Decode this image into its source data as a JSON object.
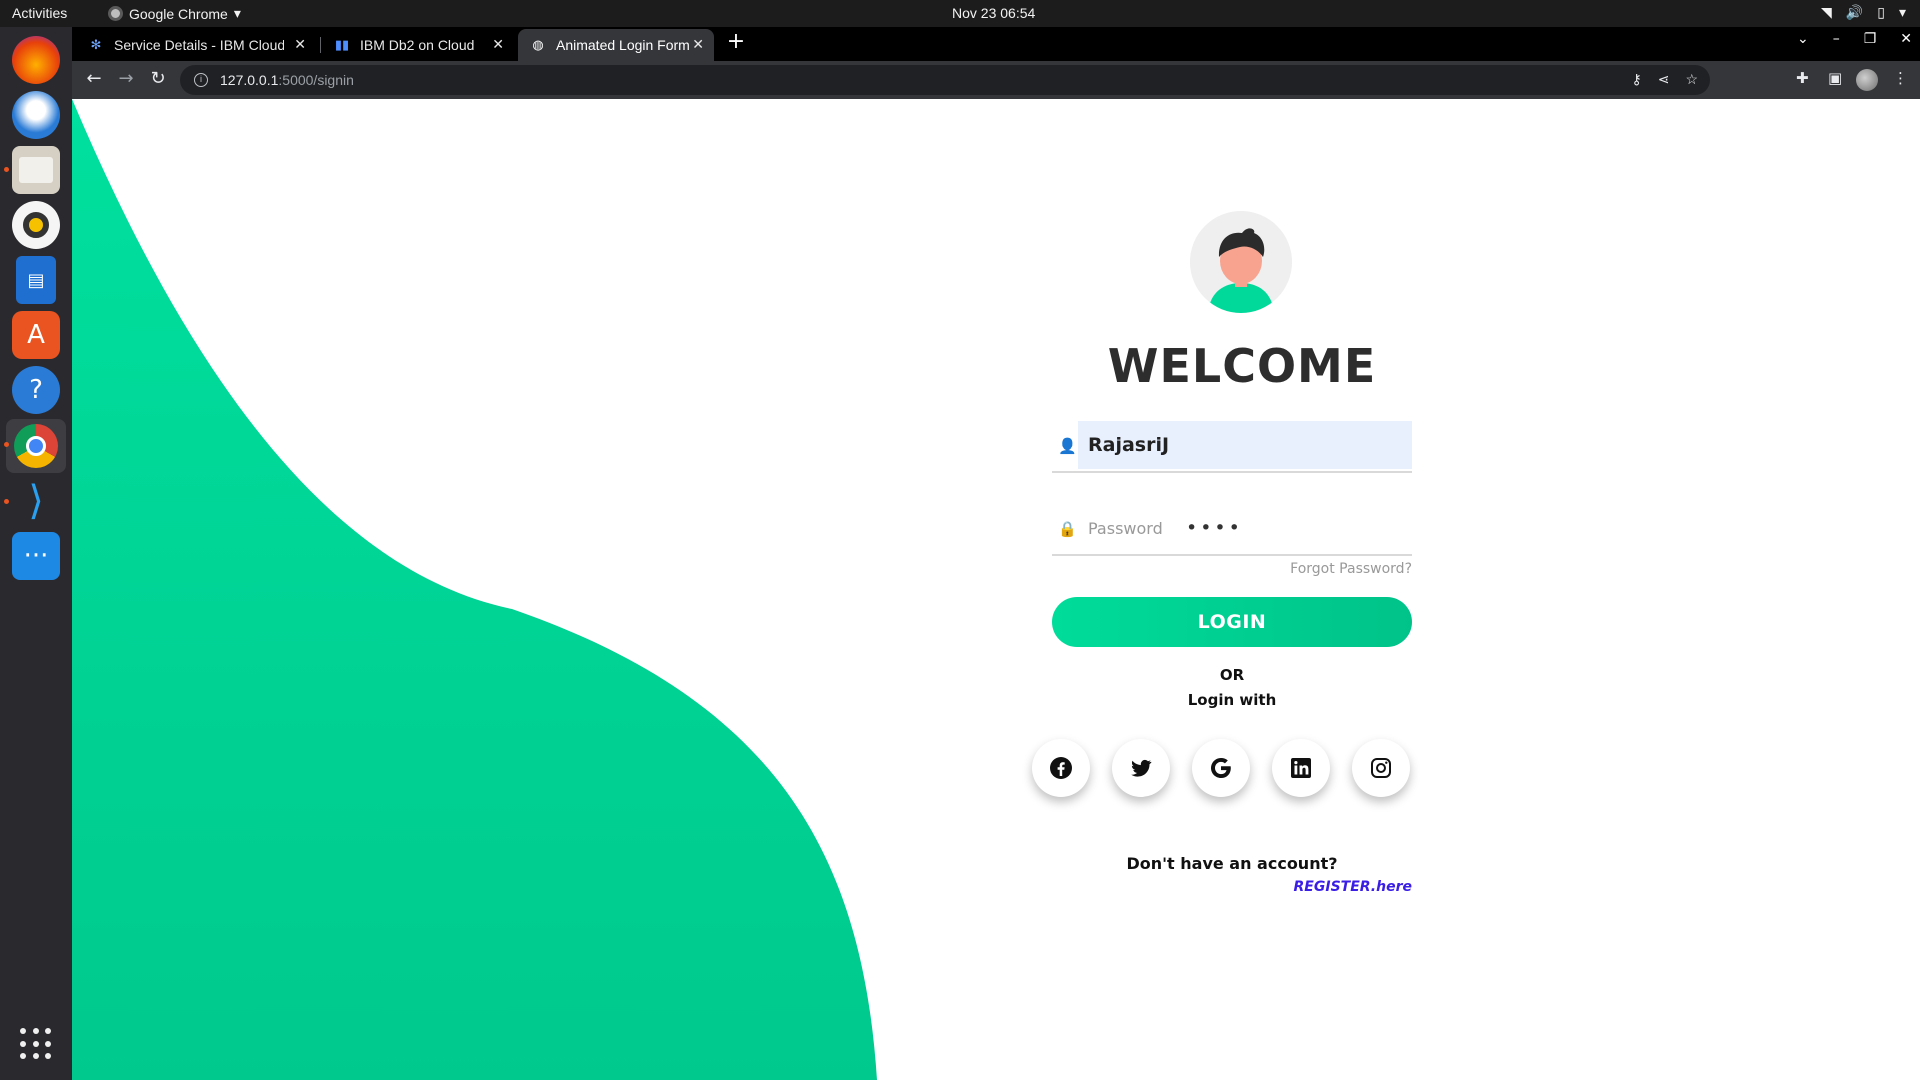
{
  "topbar": {
    "activities": "Activities",
    "app_menu": "Google Chrome",
    "clock": "Nov 23  06:54"
  },
  "dock": {
    "apps": [
      "firefox-icon",
      "thunderbird-icon",
      "files-icon",
      "rhythmbox-icon",
      "writer-icon",
      "software-icon",
      "help-icon",
      "chrome-icon",
      "vscode-icon",
      "chat-icon"
    ]
  },
  "browser": {
    "tabs": [
      {
        "title": "Service Details - IBM Cloud",
        "active": false
      },
      {
        "title": "IBM Db2 on Cloud",
        "active": false
      },
      {
        "title": "Animated Login Form",
        "active": true
      }
    ],
    "url_host": "127.0.0.1",
    "url_path": ":5000/signin"
  },
  "page": {
    "title": "WELCOME",
    "username_value": "RajasriJ",
    "password_placeholder": "Password",
    "password_value": "••••",
    "forgot": "Forgot Password?",
    "login_button": "LOGIN",
    "or": "OR",
    "login_with": "Login with",
    "socials": [
      "facebook-icon",
      "twitter-icon",
      "google-icon",
      "linkedin-icon",
      "instagram-icon"
    ],
    "no_account": "Don't have an account?",
    "register": "REGISTER.here"
  },
  "colors": {
    "accent": "#00d99a",
    "register_link": "#3a1ee6"
  }
}
